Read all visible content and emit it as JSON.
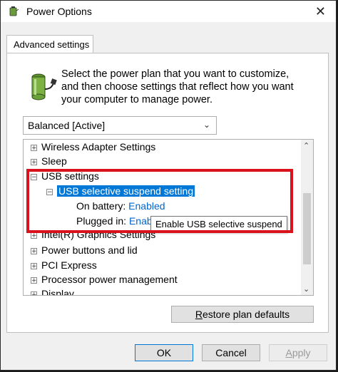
{
  "window": {
    "title": "Power Options"
  },
  "tab": {
    "label": "Advanced settings"
  },
  "description": "Select the power plan that you want to customize, and then choose settings that reflect how you want your computer to manage power.",
  "plan_select": {
    "value": "Balanced [Active]"
  },
  "tree": {
    "items": [
      {
        "label": "Wireless Adapter Settings",
        "expander": "+"
      },
      {
        "label": "Sleep",
        "expander": "+"
      },
      {
        "label": "USB settings",
        "expander": "−"
      },
      {
        "label": "USB selective suspend setting",
        "expander": "−"
      },
      {
        "label": "On battery:",
        "value": "Enabled"
      },
      {
        "label": "Plugged in:",
        "value": "Enab"
      },
      {
        "label": "Intel(R) Graphics Settings",
        "expander": "+"
      },
      {
        "label": "Power buttons and lid",
        "expander": "+"
      },
      {
        "label": "PCI Express",
        "expander": "+"
      },
      {
        "label": "Processor power management",
        "expander": "+"
      },
      {
        "label": "Display",
        "expander": "+"
      }
    ]
  },
  "tooltip": "Enable USB selective suspend",
  "buttons": {
    "restore_r": "R",
    "restore_rest": "estore plan defaults",
    "ok": "OK",
    "cancel": "Cancel",
    "apply_a": "A",
    "apply_rest": "pply"
  },
  "colors": {
    "highlight": "#d9121e",
    "selection": "#0078d7",
    "link": "#0066cc"
  }
}
